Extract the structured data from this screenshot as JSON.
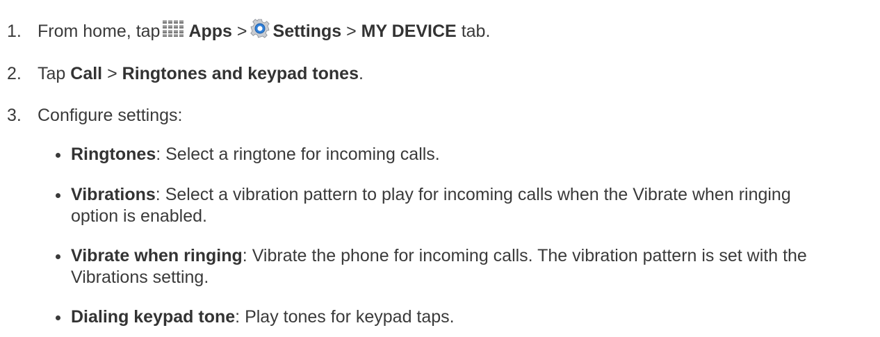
{
  "steps": [
    {
      "number": "1.",
      "t1": "From home, tap",
      "b1": "Apps",
      "t2": ">",
      "b2": "Settings",
      "t3": ">",
      "b3": "MY DEVICE",
      "t4": "tab.",
      "icons": [
        "apps-grid-icon",
        "settings-gear-icon"
      ]
    },
    {
      "number": "2.",
      "t1": "Tap",
      "b1": "Call",
      "t2": ">",
      "b2": "Ringtones and keypad tones",
      "t3": "."
    },
    {
      "number": "3.",
      "t1": "Configure settings:"
    }
  ],
  "settings": [
    {
      "label": "Ringtones",
      "description": ": Select a ringtone for incoming calls."
    },
    {
      "label": "Vibrations",
      "description": ": Select a vibration pattern to play for incoming calls when the Vibrate when ringing option is enabled."
    },
    {
      "label": "Vibrate when ringing",
      "description": ": Vibrate the phone for incoming calls. The vibration pattern is set with the Vibrations setting."
    },
    {
      "label": "Dialing keypad tone",
      "description": ": Play tones for keypad taps."
    }
  ]
}
